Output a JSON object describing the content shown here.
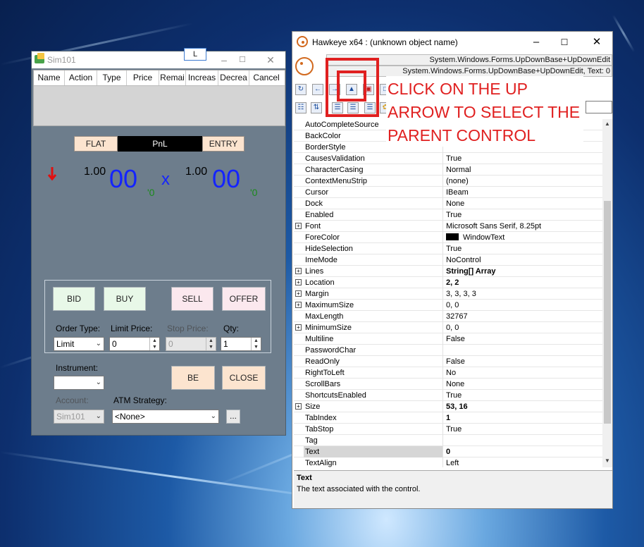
{
  "sim_window": {
    "title": "Sim101",
    "tab_label": "L",
    "orders_columns": [
      "Name",
      "Action",
      "Type",
      "Price",
      "Remai",
      "Increas",
      "Decrea",
      "Cancel"
    ],
    "flat_label": "FLAT",
    "pnl_label": "PnL",
    "entry_label": "ENTRY",
    "bid_size": "1.00",
    "bid_price": "00",
    "bid_tick": "'0",
    "times": "x",
    "ask_size": "1.00",
    "ask_price": "00",
    "ask_tick": "'0",
    "buttons": {
      "bid": "BID",
      "buy": "BUY",
      "sell": "SELL",
      "offer": "OFFER",
      "be": "BE",
      "close": "CLOSE"
    },
    "order_type_label": "Order Type:",
    "order_type_value": "Limit",
    "limit_price_label": "Limit Price:",
    "limit_price_value": "0",
    "stop_price_label": "Stop Price:",
    "stop_price_value": "0",
    "qty_label": "Qty:",
    "qty_value": "1",
    "instrument_label": "Instrument:",
    "instrument_value": "",
    "account_label": "Account:",
    "account_value": "Sim101",
    "atm_label": "ATM Strategy:",
    "atm_value": "<None>",
    "ellipsis_label": "..."
  },
  "hawkeye": {
    "title": "Hawkeye x64 : (unknown object name)",
    "object_type": "System.Windows.Forms.UpDownBase+UpDownEdit",
    "object_detail": "System.Windows.Forms.UpDownBase+UpDownEdit, Text: 0",
    "properties": [
      {
        "name": "AutoCompleteSource",
        "value": "",
        "expand": false,
        "bold": false
      },
      {
        "name": "BackColor",
        "value": "",
        "expand": false,
        "bold": false
      },
      {
        "name": "BorderStyle",
        "value": "",
        "expand": false,
        "bold": false
      },
      {
        "name": "CausesValidation",
        "value": "True",
        "expand": false,
        "bold": false
      },
      {
        "name": "CharacterCasing",
        "value": "Normal",
        "expand": false,
        "bold": false
      },
      {
        "name": "ContextMenuStrip",
        "value": "(none)",
        "expand": false,
        "bold": false
      },
      {
        "name": "Cursor",
        "value": "IBeam",
        "expand": false,
        "bold": false
      },
      {
        "name": "Dock",
        "value": "None",
        "expand": false,
        "bold": false
      },
      {
        "name": "Enabled",
        "value": "True",
        "expand": false,
        "bold": false
      },
      {
        "name": "Font",
        "value": "Microsoft Sans Serif, 8.25pt",
        "expand": true,
        "bold": false
      },
      {
        "name": "ForeColor",
        "value": "WindowText",
        "expand": false,
        "bold": false,
        "swatch": "#000000"
      },
      {
        "name": "HideSelection",
        "value": "True",
        "expand": false,
        "bold": false
      },
      {
        "name": "ImeMode",
        "value": "NoControl",
        "expand": false,
        "bold": false
      },
      {
        "name": "Lines",
        "value": "String[] Array",
        "expand": true,
        "bold": true
      },
      {
        "name": "Location",
        "value": "2, 2",
        "expand": true,
        "bold": true
      },
      {
        "name": "Margin",
        "value": "3, 3, 3, 3",
        "expand": true,
        "bold": false
      },
      {
        "name": "MaximumSize",
        "value": "0, 0",
        "expand": true,
        "bold": false
      },
      {
        "name": "MaxLength",
        "value": "32767",
        "expand": false,
        "bold": false
      },
      {
        "name": "MinimumSize",
        "value": "0, 0",
        "expand": true,
        "bold": false
      },
      {
        "name": "Multiline",
        "value": "False",
        "expand": false,
        "bold": false
      },
      {
        "name": "PasswordChar",
        "value": "",
        "expand": false,
        "bold": false
      },
      {
        "name": "ReadOnly",
        "value": "False",
        "expand": false,
        "bold": false
      },
      {
        "name": "RightToLeft",
        "value": "No",
        "expand": false,
        "bold": false
      },
      {
        "name": "ScrollBars",
        "value": "None",
        "expand": false,
        "bold": false
      },
      {
        "name": "ShortcutsEnabled",
        "value": "True",
        "expand": false,
        "bold": false
      },
      {
        "name": "Size",
        "value": "53, 16",
        "expand": true,
        "bold": true
      },
      {
        "name": "TabIndex",
        "value": "1",
        "expand": false,
        "bold": true
      },
      {
        "name": "TabStop",
        "value": "True",
        "expand": false,
        "bold": false
      },
      {
        "name": "Tag",
        "value": "",
        "expand": false,
        "bold": false
      },
      {
        "name": "Text",
        "value": "0",
        "expand": false,
        "bold": true,
        "selected": true
      },
      {
        "name": "TextAlign",
        "value": "Left",
        "expand": false,
        "bold": false
      }
    ],
    "description_title": "Text",
    "description_text": "The text associated with the control."
  },
  "annotation": {
    "line1": "CLICK ON THE UP",
    "line2": "ARROW TO SELECT THE",
    "line3": "PARENT CONTROL"
  },
  "colors": {
    "annotation_red": "#e02020",
    "price_blue": "#1424ff",
    "tick_green": "#1a8a1a",
    "sell_arrow_red": "#e01010"
  }
}
